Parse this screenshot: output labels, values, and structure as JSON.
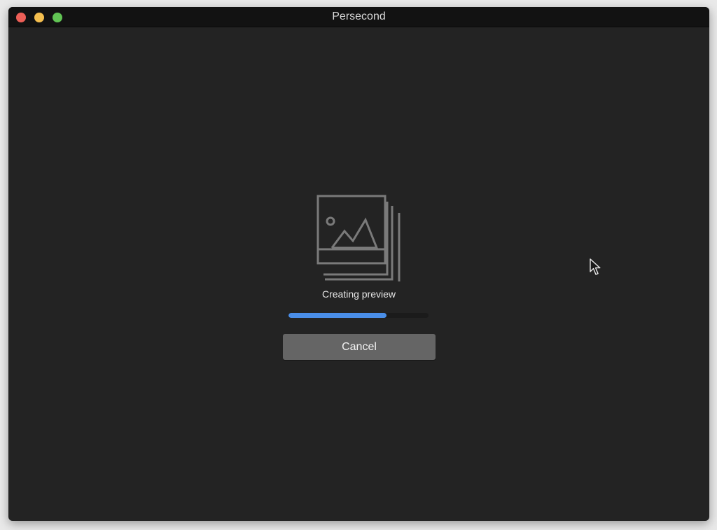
{
  "window": {
    "title": "Persecond",
    "traffic_lights": {
      "close_color": "#ed5f57",
      "minimize_color": "#f5bf4f",
      "maximize_color": "#61c454"
    }
  },
  "preview": {
    "icon": "image-stack-icon",
    "status_text": "Creating preview",
    "progress": 0.7,
    "progress_color": "#4a8ee8",
    "cancel_label": "Cancel"
  }
}
